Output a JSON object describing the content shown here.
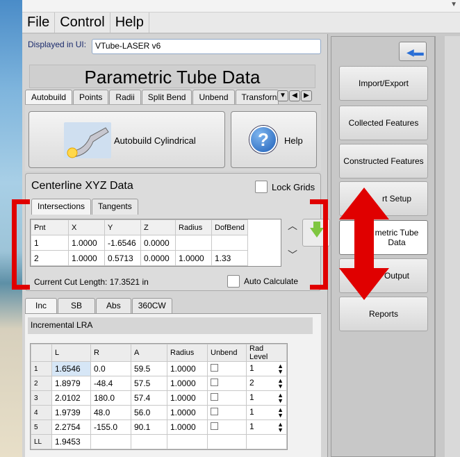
{
  "menu": [
    "File",
    "Control",
    "Help"
  ],
  "displayed_in_ui": {
    "label": "Displayed in UI:",
    "value": "VTube-LASER v6"
  },
  "panel_title": "Parametric Tube Data",
  "top_tabs": [
    "Autobuild",
    "Points",
    "Radii",
    "Split Bend",
    "Unbend",
    "Transforn"
  ],
  "autobuild_button": "Autobuild Cylindrical",
  "help_button": "Help",
  "centerline": {
    "title": "Centerline XYZ Data",
    "lock_grids": "Lock Grids",
    "tabs": [
      "Intersections",
      "Tangents"
    ],
    "columns": [
      "Pnt",
      "X",
      "Y",
      "Z",
      "Radius",
      "DofBend"
    ],
    "rows": [
      [
        "1",
        "1.0000",
        "-1.6546",
        "0.0000",
        "",
        ""
      ],
      [
        "2",
        "1.0000",
        "0.5713",
        "0.0000",
        "1.0000",
        "1.33"
      ]
    ],
    "cut_length": "Current Cut Length: 17.3521 in",
    "auto_calculate": "Auto Calculate"
  },
  "lra": {
    "tabs": [
      "Inc",
      "SB",
      "Abs",
      "360CW"
    ],
    "title": "Incremental LRA",
    "columns": [
      "",
      "L",
      "R",
      "A",
      "Radius",
      "Unbend",
      "Rad Level"
    ],
    "rows": [
      {
        "n": "1",
        "L": "1.6546",
        "R": "0.0",
        "A": "59.5",
        "Radius": "1.0000",
        "level": "1"
      },
      {
        "n": "2",
        "L": "1.8979",
        "R": "-48.4",
        "A": "57.5",
        "Radius": "1.0000",
        "level": "2"
      },
      {
        "n": "3",
        "L": "2.0102",
        "R": "180.0",
        "A": "57.4",
        "Radius": "1.0000",
        "level": "1"
      },
      {
        "n": "4",
        "L": "1.9739",
        "R": "48.0",
        "A": "56.0",
        "Radius": "1.0000",
        "level": "1"
      },
      {
        "n": "5",
        "L": "2.2754",
        "R": "-155.0",
        "A": "90.1",
        "Radius": "1.0000",
        "level": "1"
      }
    ],
    "ll_label": "LL",
    "ll_value": "1.9453"
  },
  "side_buttons": [
    "Import/Export",
    "Collected Features",
    "Constructed Features",
    "rt Setup",
    "metric Tube\nData",
    "Output",
    "Reports"
  ],
  "colors": {
    "accent_red": "#e00000",
    "arrow_green": "#7fc640",
    "nav_blue": "#2a6fd6"
  }
}
